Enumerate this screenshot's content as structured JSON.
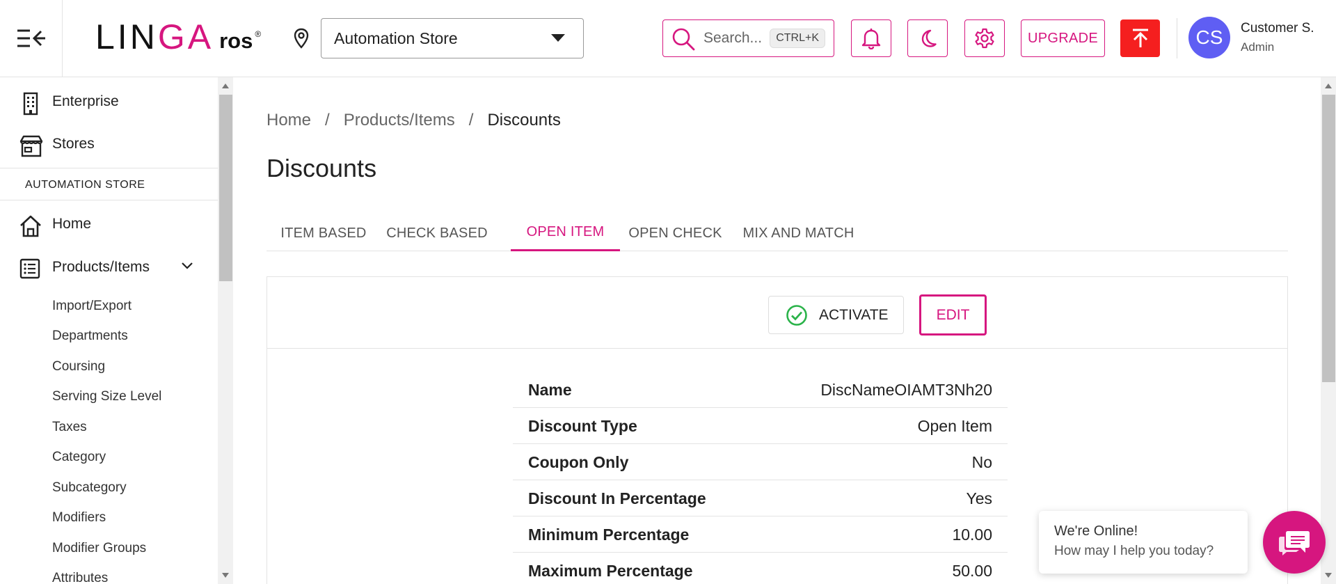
{
  "header": {
    "logo": {
      "part1": "LIN",
      "part2": "G",
      "part3": "A",
      "ros": "ros",
      "reg": "®"
    },
    "store": {
      "selected": "Automation Store"
    },
    "search": {
      "placeholder": "Search...",
      "shortcut": "CTRL+K"
    },
    "upgrade_label": "UPGRADE",
    "user": {
      "initials": "CS",
      "name": "Customer S.",
      "role": "Admin"
    }
  },
  "sidebar": {
    "top_items": [
      {
        "label": "Enterprise",
        "icon": "building-icon"
      },
      {
        "label": "Stores",
        "icon": "store-icon"
      }
    ],
    "section_title": "AUTOMATION STORE",
    "main_items": [
      {
        "label": "Home",
        "icon": "home-icon"
      },
      {
        "label": "Products/Items",
        "icon": "list-icon"
      }
    ],
    "sub_items": [
      "Import/Export",
      "Departments",
      "Coursing",
      "Serving Size Level",
      "Taxes",
      "Category",
      "Subcategory",
      "Modifiers",
      "Modifier Groups",
      "Attributes"
    ]
  },
  "main": {
    "breadcrumb": [
      "Home",
      "Products/Items",
      "Discounts"
    ],
    "breadcrumb_sep": "/",
    "title": "Discounts",
    "tabs": [
      "ITEM BASED",
      "CHECK BASED",
      "OPEN ITEM",
      "OPEN CHECK",
      "MIX AND MATCH"
    ],
    "active_tab": "OPEN ITEM",
    "actions": {
      "activate": "ACTIVATE",
      "edit": "EDIT"
    },
    "details": [
      {
        "key": "Name",
        "value": "DiscNameOIAMT3Nh20"
      },
      {
        "key": "Discount Type",
        "value": "Open Item"
      },
      {
        "key": "Coupon Only",
        "value": "No"
      },
      {
        "key": "Discount In Percentage",
        "value": "Yes"
      },
      {
        "key": "Minimum Percentage",
        "value": "10.00"
      },
      {
        "key": "Maximum Percentage",
        "value": "50.00"
      }
    ]
  },
  "chat": {
    "line1": "We're Online!",
    "line2": "How may I help you today?"
  },
  "colors": {
    "accent": "#d6167f",
    "publish": "#f51f1f",
    "avatar": "#5f5ef3",
    "success": "#2bb34a"
  }
}
